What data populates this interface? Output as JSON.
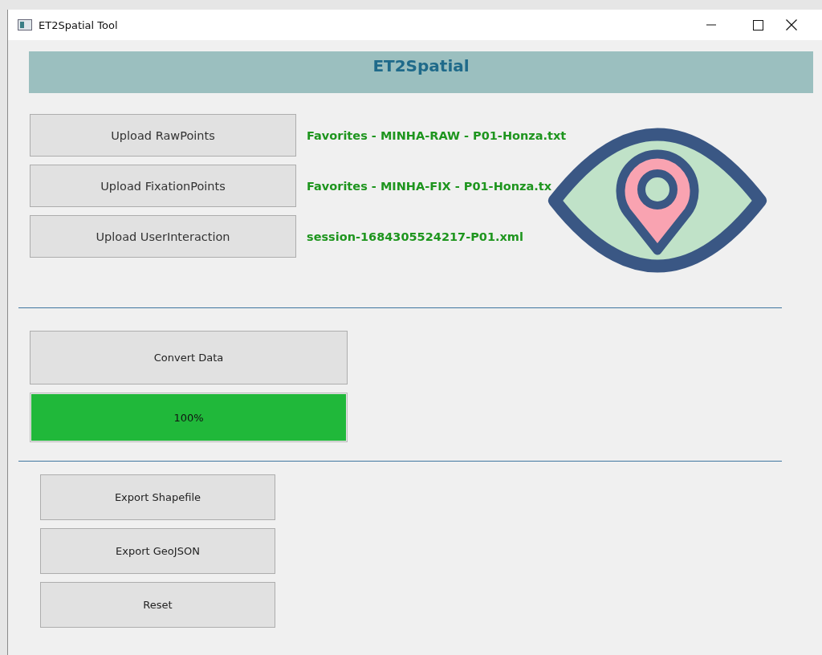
{
  "window": {
    "title": "ET2Spatial Tool"
  },
  "header": {
    "title": "ET2Spatial"
  },
  "uploads": [
    {
      "button": "Upload RawPoints",
      "file": "Favorites - MINHA-RAW - P01-Honza.txt"
    },
    {
      "button": "Upload FixationPoints",
      "file": "Favorites - MINHA-FIX - P01-Honza.tx"
    },
    {
      "button": "Upload UserInteraction",
      "file": "session-1684305524217-P01.xml"
    }
  ],
  "convert": {
    "button": "Convert Data"
  },
  "progress": {
    "level": 1,
    "reading": "100%"
  },
  "exports": [
    "Export Shapefile",
    "Export GeoJSON",
    "Reset"
  ]
}
